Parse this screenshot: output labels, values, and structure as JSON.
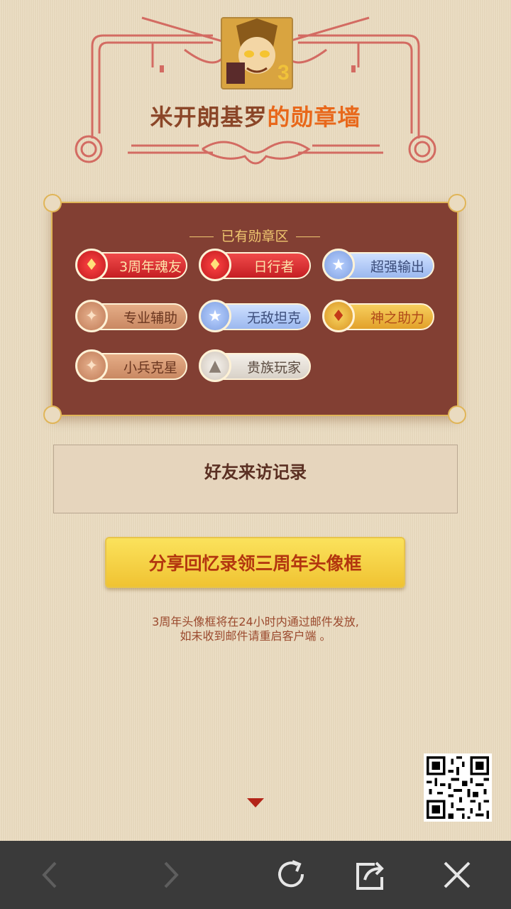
{
  "header": {
    "player_name": "米开朗基罗",
    "title_suffix": "的勋章墙"
  },
  "medal_panel": {
    "title": "已有勋章区",
    "badges": [
      {
        "label": "3周年魂友",
        "style": "red",
        "icon": "diamond-icon"
      },
      {
        "label": "日行者",
        "style": "red",
        "icon": "diamond-icon"
      },
      {
        "label": "超强输出",
        "style": "blue",
        "icon": "star-icon"
      },
      {
        "label": "专业辅助",
        "style": "bronze",
        "icon": "sparkle-icon"
      },
      {
        "label": "无敌坦克",
        "style": "blue",
        "icon": "star-icon"
      },
      {
        "label": "神之助力",
        "style": "gold",
        "icon": "diamond-icon"
      },
      {
        "label": "小兵克星",
        "style": "bronze",
        "icon": "sparkle-icon"
      },
      {
        "label": "贵族玩家",
        "style": "silver",
        "icon": "triangle-icon"
      }
    ]
  },
  "visits": {
    "title": "好友来访记录"
  },
  "share": {
    "button_label": "分享回忆录领三周年头像框",
    "note_line1": "3周年头像框将在24小时内通过邮件发放,",
    "note_line2": "如未收到邮件请重启客户端 。"
  },
  "bottom_nav": {
    "icons": [
      "back-icon",
      "forward-icon",
      "refresh-icon",
      "share-icon",
      "close-icon"
    ]
  },
  "colors": {
    "background": "#eadbc0",
    "panel": "#823f33",
    "accent_orange": "#e8681b",
    "button_yellow": "#f0c332"
  }
}
